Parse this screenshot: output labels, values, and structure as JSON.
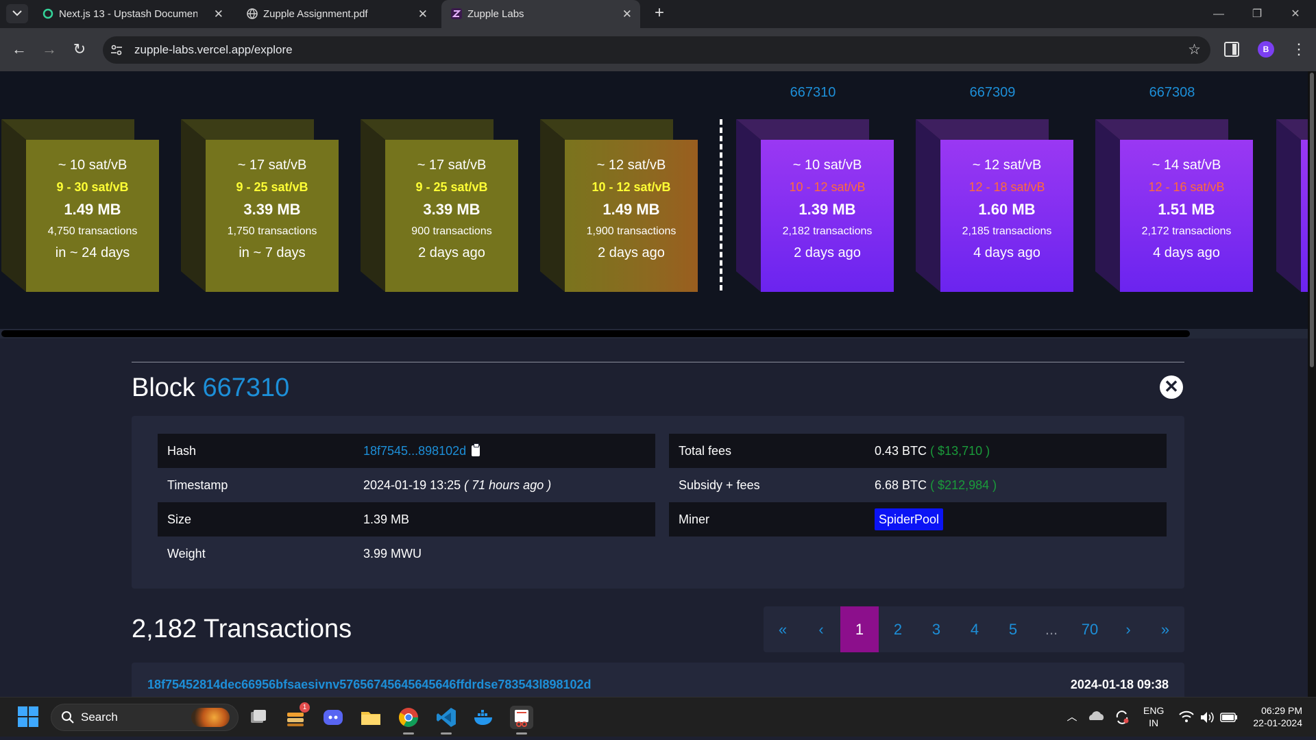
{
  "browser": {
    "tabs": [
      {
        "title": "Next.js 13 - Upstash Documentation",
        "active": false
      },
      {
        "title": "Zupple Assignment.pdf",
        "active": false
      },
      {
        "title": "Zupple Labs",
        "active": true
      }
    ],
    "url": "zupple-labs.vercel.app/explore",
    "profile_initial": "B"
  },
  "mempool_blocks": [
    {
      "median_fee": "~ 10 sat/vB",
      "fee_range": "9 - 30 sat/vB",
      "size": "1.49 MB",
      "tx_count": "4,750 transactions",
      "eta": "in ~ 24 days"
    },
    {
      "median_fee": "~ 17 sat/vB",
      "fee_range": "9 - 25 sat/vB",
      "size": "3.39 MB",
      "tx_count": "1,750 transactions",
      "eta": "in ~ 7 days"
    },
    {
      "median_fee": "~ 17 sat/vB",
      "fee_range": "9 - 25 sat/vB",
      "size": "3.39 MB",
      "tx_count": "900 transactions",
      "eta": "2 days ago"
    },
    {
      "median_fee": "~ 12 sat/vB",
      "fee_range": "10 - 12 sat/vB",
      "size": "1.49 MB",
      "tx_count": "1,900 transactions",
      "eta": "2 days ago"
    }
  ],
  "mined_blocks": [
    {
      "height": "667310",
      "median_fee": "~ 10 sat/vB",
      "fee_range": "10 - 12 sat/vB",
      "size": "1.39 MB",
      "tx_count": "2,182 transactions",
      "time": "2 days ago"
    },
    {
      "height": "667309",
      "median_fee": "~ 12 sat/vB",
      "fee_range": "12 - 18 sat/vB",
      "size": "1.60 MB",
      "tx_count": "2,185 transactions",
      "time": "4 days ago"
    },
    {
      "height": "667308",
      "median_fee": "~ 14 sat/vB",
      "fee_range": "12 - 16 sat/vB",
      "size": "1.51 MB",
      "tx_count": "2,172 transactions",
      "time": "4 days ago"
    }
  ],
  "block_detail": {
    "title": "Block",
    "height": "667310",
    "left": [
      {
        "label": "Hash",
        "value": "18f7545...898102d"
      },
      {
        "label": "Timestamp",
        "value": "2024-01-19 13:25",
        "extra": "( 71 hours ago )"
      },
      {
        "label": "Size",
        "value": "1.39 MB"
      },
      {
        "label": "Weight",
        "value": "3.99 MWU"
      }
    ],
    "right": [
      {
        "label": "Total fees",
        "value": "0.43 BTC",
        "usd": "( $13,710 )"
      },
      {
        "label": "Subsidy + fees",
        "value": "6.68 BTC",
        "usd": "( $212,984 )"
      },
      {
        "label": "Miner",
        "value": "SpiderPool"
      }
    ]
  },
  "transactions": {
    "title": "2,182 Transactions",
    "pagination": [
      "«",
      "‹",
      "1",
      "2",
      "3",
      "4",
      "5",
      "...",
      "70",
      "›",
      "»"
    ],
    "current_page": "1",
    "first_tx": {
      "hash": "18f75452814dec66956bfsaesivnv57656745645645646ffdrdse783543l898102d",
      "date": "2024-01-18 09:38"
    }
  },
  "taskbar": {
    "search_label": "Search",
    "notification_count": "1",
    "lang": "ENG",
    "region": "IN",
    "time": "06:29 PM",
    "date": "22-01-2024"
  },
  "colors": {
    "accent_blue": "#1d8fd8",
    "mempool_block": "#75741d",
    "mined_block": "#7b2cf1",
    "current_page": "#8c0f8c",
    "usd_green": "#1a9b3a"
  }
}
